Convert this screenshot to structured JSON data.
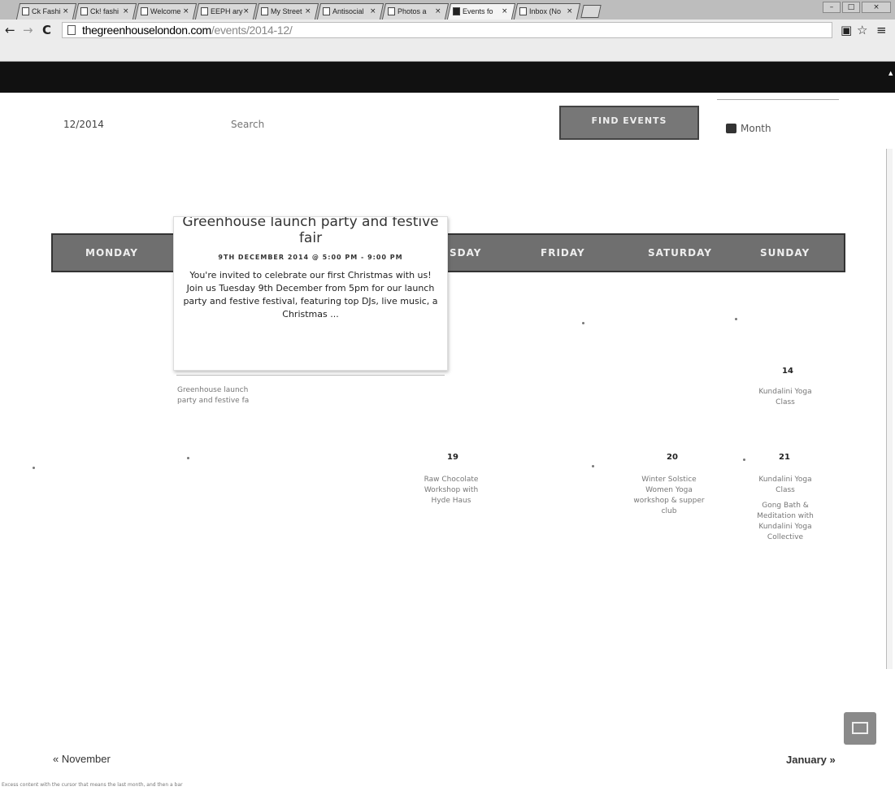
{
  "browser": {
    "tabs": [
      {
        "label": "Ck Fashi"
      },
      {
        "label": "Ck! fashi"
      },
      {
        "label": "Welcome"
      },
      {
        "label": "EEPH ary"
      },
      {
        "label": "My Street"
      },
      {
        "label": "Antisocial"
      },
      {
        "label": "Photos a"
      },
      {
        "label": "Events fo",
        "active": true
      },
      {
        "label": "Inbox (No"
      }
    ],
    "tab_close": "×",
    "url_host": "thegreenhouselondon.com",
    "url_path": "/events/2014-12/",
    "nav": {
      "back": "←",
      "forward": "→",
      "reload": "C"
    },
    "toolbar_icons": {
      "star": "☆",
      "menu": "≡",
      "cast": "▣"
    },
    "window_buttons": {
      "minimize": "–",
      "maximize": "□",
      "close": "×"
    }
  },
  "filters": {
    "date_value": "12/2014",
    "search_placeholder": "Search",
    "find_button": "FIND EVENTS",
    "view_label": "Month"
  },
  "calendar": {
    "weekdays": [
      "MONDAY",
      "SDAY",
      "FRIDAY",
      "SATURDAY",
      "SUNDAY"
    ],
    "cells": [
      {
        "day": "14",
        "events": [
          "Kundalini Yoga",
          "Class"
        ]
      },
      {
        "day": "19",
        "events": [
          "Raw Chocolate",
          "Workshop with",
          "Hyde Haus"
        ]
      },
      {
        "day": "20",
        "events": [
          "Winter Solstice",
          "Women Yoga",
          "workshop & supper",
          "club"
        ]
      },
      {
        "day": "21",
        "events": [
          "Kundalini Yoga",
          "Class",
          "",
          "Gong Bath &",
          "Meditation with",
          "Kundalini Yoga",
          "Collective"
        ]
      }
    ],
    "mon_event": [
      "Greenhouse launch",
      "party and festive fa"
    ]
  },
  "tooltip": {
    "title_line1": "Greenhouse launch party and festive",
    "title_line2": "fair",
    "date": "9TH DECEMBER 2014 @ 5:00 PM - 9:00 PM",
    "description": "You're invited to celebrate our first Christmas with us! Join us Tuesday 9th December from 5pm for our launch party and festive festival, featuring top DJs, live music, a Christmas ..."
  },
  "footer": {
    "prev": "« November",
    "next": "January »",
    "footnote": "Excess content with the cursor that means the last month, and then a bar"
  },
  "icons": {
    "calendar": "calendar-icon",
    "mail": "mail-icon"
  }
}
